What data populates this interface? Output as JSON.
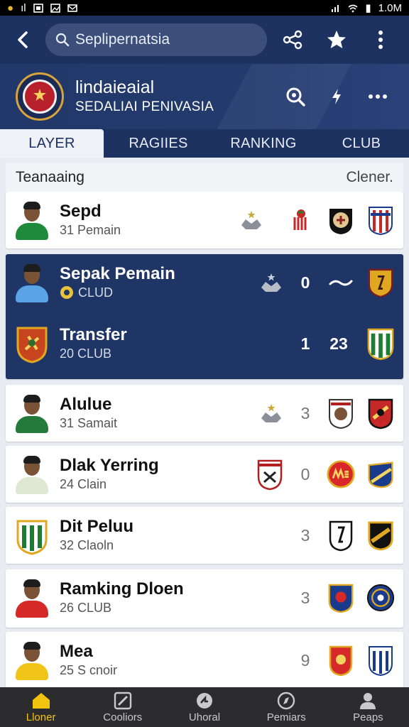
{
  "status": {
    "time": "1.0M",
    "battery": "▮"
  },
  "search": {
    "value": "Seplipernatsia",
    "placeholder": "Seplipernatsia"
  },
  "header": {
    "title": "lindaieaial",
    "subtitle": "SEDALIAI PENIVASIA"
  },
  "tabs": [
    {
      "label": "LAYER",
      "active": true
    },
    {
      "label": "RAGIIES",
      "active": false
    },
    {
      "label": "RANKING",
      "active": false
    },
    {
      "label": "CLUB",
      "active": false
    }
  ],
  "list_header": {
    "left": "Teanaaing",
    "right": "Clener."
  },
  "rows": [
    {
      "name": "Sepd",
      "sub": "31 Pemain"
    },
    {
      "name": "Sepak Pemain",
      "sub": "CLUD",
      "value": "0"
    },
    {
      "name": "Transfer",
      "sub": "20 CLUB",
      "value1": "1",
      "value2": "23"
    },
    {
      "name": "Alulue",
      "sub": "31 Samait",
      "value": "3"
    },
    {
      "name": "Dlak Yerring",
      "sub": "24 Clain",
      "value": "0"
    },
    {
      "name": "Dit Peluu",
      "sub": "32 Claoln",
      "value": "3"
    },
    {
      "name": "Ramking Dloen",
      "sub": "26 CLUB",
      "value": "3"
    },
    {
      "name": "Mea",
      "sub": "25 S cnoir",
      "value": "9"
    }
  ],
  "nav": [
    {
      "label": "Lloner",
      "icon": "home-icon",
      "active": true
    },
    {
      "label": "Cooliors",
      "icon": "edit-icon",
      "active": false
    },
    {
      "label": "Uhoral",
      "icon": "refresh-icon",
      "active": false
    },
    {
      "label": "Pemiars",
      "icon": "compass-icon",
      "active": false
    },
    {
      "label": "Peaps",
      "icon": "person-icon",
      "active": false
    }
  ],
  "colors": {
    "primary": "#1d3261",
    "accent": "#f1c40f",
    "nav_bg": "#2c2c2e"
  }
}
